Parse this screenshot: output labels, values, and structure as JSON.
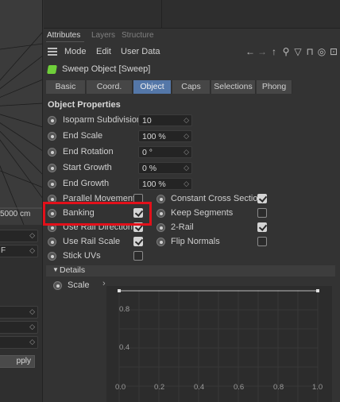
{
  "viewport": {
    "readout": "5000 cm"
  },
  "left_panel": {
    "field_values": [
      "",
      "F",
      "",
      "",
      ""
    ],
    "apply_label": "pply"
  },
  "tabs": [
    "Attributes",
    "Layers",
    "Structure"
  ],
  "menu": {
    "mode": "Mode",
    "edit": "Edit",
    "user_data": "User Data"
  },
  "toolbar_icons": [
    "back-arrow-icon",
    "forward-arrow-icon",
    "up-arrow-icon",
    "search-icon",
    "filter-icon",
    "lock-icon",
    "target-icon",
    "new-panel-icon"
  ],
  "object_title": "Sweep Object [Sweep]",
  "subtabs": [
    "Basic",
    "Coord.",
    "Object",
    "Caps",
    "Selections",
    "Phong"
  ],
  "active_subtab": "Object",
  "section_title": "Object Properties",
  "numeric_params": [
    {
      "label": "Isoparm Subdivision",
      "value": "10"
    },
    {
      "label": "End Scale",
      "value": "100 %"
    },
    {
      "label": "End Rotation",
      "value": "0 °"
    },
    {
      "label": "Start Growth",
      "value": "0 %"
    },
    {
      "label": "End Growth",
      "value": "100 %"
    }
  ],
  "checkbox_left": [
    {
      "label": "Parallel Movement",
      "checked": false
    },
    {
      "label": "Banking",
      "checked": true
    },
    {
      "label": "Use Rail Direction",
      "checked": true
    },
    {
      "label": "Use Rail Scale",
      "checked": true
    },
    {
      "label": "Stick UVs",
      "checked": false
    }
  ],
  "checkbox_right": [
    {
      "label": "Constant Cross Section",
      "checked": true
    },
    {
      "label": "Keep Segments",
      "checked": false
    },
    {
      "label": "2-Rail",
      "checked": true
    },
    {
      "label": "Flip Normals",
      "checked": false
    }
  ],
  "details": {
    "label": "Details",
    "scale_label": "Scale"
  },
  "graph": {
    "y_ticks": [
      "0.8",
      "0.4"
    ],
    "x_ticks": [
      "0.0",
      "0.2",
      "0.4",
      "0.6",
      "0.8",
      "1.0"
    ]
  },
  "colors": {
    "accent_tab": "#5477a8",
    "highlight": "#e3101a",
    "object_icon": "#6fcf3a"
  }
}
